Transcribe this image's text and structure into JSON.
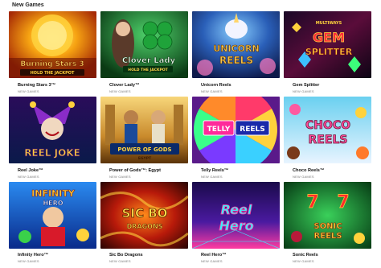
{
  "section": {
    "title": "New Games"
  },
  "games": [
    {
      "title": "Burning Stars 3™",
      "category": "NEW GAMES",
      "logo_line1": "Burning Stars 3",
      "logo_line2": "HOLD THE JACKPOT"
    },
    {
      "title": "Clover Lady™",
      "category": "NEW GAMES",
      "logo_line1": "Clover Lady",
      "logo_line2": "HOLD THE JACKPOT"
    },
    {
      "title": "Unicorn Reels",
      "category": "NEW GAMES",
      "logo_line1": "UNICORN",
      "logo_line2": "REELS"
    },
    {
      "title": "Gem Splitter",
      "category": "NEW GAMES",
      "logo_line0": "MULTIWAYS",
      "logo_line1": "GEM",
      "logo_line2": "SPLITTER"
    },
    {
      "title": "Reel Joke™",
      "category": "NEW GAMES",
      "logo_line1": "REEL JOKE"
    },
    {
      "title": "Power of Gods™: Egypt",
      "category": "NEW GAMES",
      "logo_line1": "POWER OF GODS",
      "logo_line2": "EGYPT"
    },
    {
      "title": "Telly Reels™",
      "category": "NEW GAMES",
      "logo_line1": "TELLY",
      "logo_line2": "REELS"
    },
    {
      "title": "Choco Reels™",
      "category": "NEW GAMES",
      "logo_line1": "CHOCO",
      "logo_line2": "REELS"
    },
    {
      "title": "Infinity Hero™",
      "category": "NEW GAMES",
      "logo_line1": "INFINITY",
      "logo_line2": "HERO"
    },
    {
      "title": "Sic Bo Dragons",
      "category": "NEW GAMES",
      "logo_line1": "SIC BO",
      "logo_line2": "DRAGONS"
    },
    {
      "title": "Reel Hero™",
      "category": "NEW GAMES",
      "logo_line1": "Reel",
      "logo_line2": "Hero"
    },
    {
      "title": "Sonic Reels",
      "category": "NEW GAMES",
      "logo_line1": "SONIC",
      "logo_line2": "REELS"
    }
  ]
}
